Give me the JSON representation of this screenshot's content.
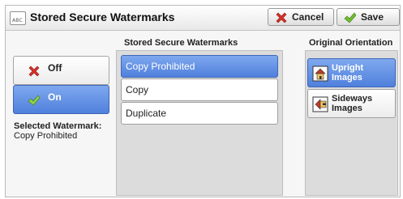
{
  "header": {
    "icon_text": "ABC",
    "title": "Stored Secure Watermarks",
    "cancel_label": "Cancel",
    "save_label": "Save"
  },
  "watermark_toggle": {
    "options": [
      "Off",
      "On"
    ],
    "selected": "On"
  },
  "selected_watermark": {
    "label": "Selected Watermark:",
    "value": "Copy Prohibited"
  },
  "stored_list": {
    "heading": "Stored Secure Watermarks",
    "items": [
      "Copy Prohibited",
      "Copy",
      "Duplicate"
    ],
    "selected": "Copy Prohibited"
  },
  "orientation": {
    "heading": "Original Orientation",
    "upright_label": "Upright Images",
    "sideways_label": "Sideways Images",
    "selected": "Upright Images"
  },
  "icons": {
    "cancel": "red-x-icon",
    "save": "green-check-icon",
    "upright": "upright-image-icon",
    "sideways": "sideways-image-icon"
  },
  "colors": {
    "selected_fill": "#5b8ae0",
    "cancel_icon": "#d8302a",
    "check_icon": "#6fbe2e"
  }
}
